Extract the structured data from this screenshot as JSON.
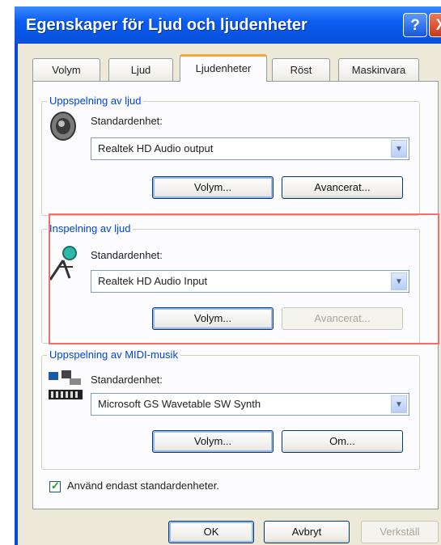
{
  "window": {
    "title": "Egenskaper för Ljud och ljudenheter"
  },
  "title_buttons": {
    "help": "?",
    "close": "X"
  },
  "tabs": [
    {
      "label": "Volym"
    },
    {
      "label": "Ljud"
    },
    {
      "label": "Ljudenheter"
    },
    {
      "label": "Röst"
    },
    {
      "label": "Maskinvara"
    }
  ],
  "active_tab": "Ljudenheter",
  "playback": {
    "legend": "Uppspelning av ljud",
    "device_label": "Standardenhet:",
    "device_value": "Realtek HD Audio output",
    "volume_button": "Volym...",
    "advanced_button": "Avancerat..."
  },
  "recording": {
    "legend": "Inspelning av ljud",
    "device_label": "Standardenhet:",
    "device_value": "Realtek HD Audio Input",
    "volume_button": "Volym...",
    "advanced_button": "Avancerat..."
  },
  "midi": {
    "legend": "Uppspelning av MIDI-musik",
    "device_label": "Standardenhet:",
    "device_value": "Microsoft GS Wavetable SW Synth",
    "volume_button": "Volym...",
    "about_button": "Om..."
  },
  "use_default_only": {
    "label": "Använd endast standardenheter.",
    "checked": true
  },
  "footer": {
    "ok": "OK",
    "cancel": "Avbryt",
    "apply": "Verkställ"
  },
  "colors": {
    "highlight_border": "#f07070",
    "accent": "#0046d5"
  }
}
